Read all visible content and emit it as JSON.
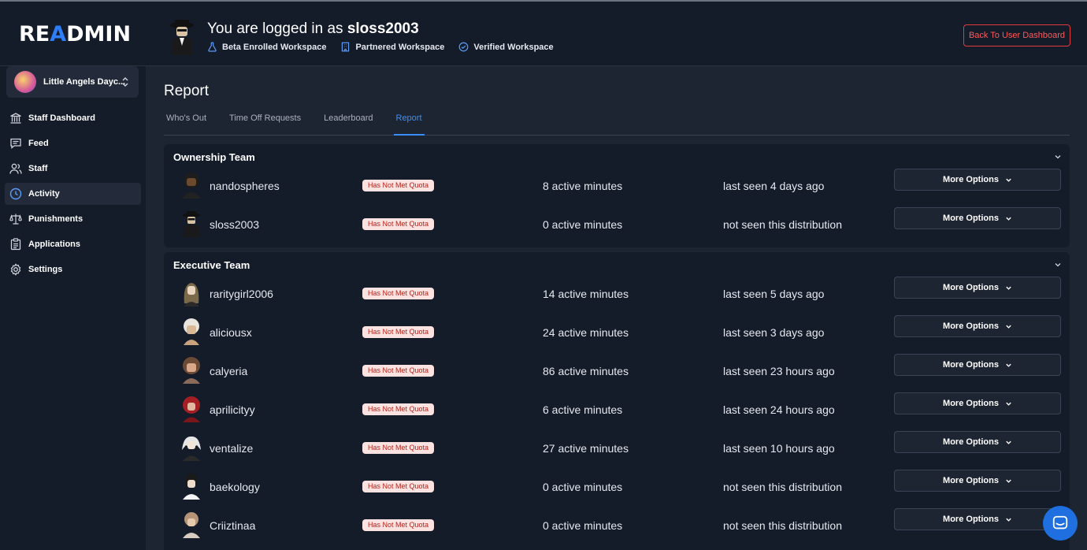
{
  "header": {
    "logo_main": "RE",
    "logo_accent": "A",
    "logo_rest": "DMIN",
    "logged_prefix": "You are logged in as ",
    "username": "sloss2003",
    "badges": [
      "Beta Enrolled Workspace",
      "Partnered Workspace",
      "Verified Workspace"
    ],
    "back_button": "Back To User Dashboard"
  },
  "sidebar": {
    "workspace_name": "Little Angels Dayc...",
    "items": [
      {
        "label": "Staff Dashboard",
        "icon": "bank-icon"
      },
      {
        "label": "Feed",
        "icon": "chat-icon"
      },
      {
        "label": "Staff",
        "icon": "users-icon"
      },
      {
        "label": "Activity",
        "icon": "clock-icon"
      },
      {
        "label": "Punishments",
        "icon": "scale-icon"
      },
      {
        "label": "Applications",
        "icon": "clipboard-icon"
      },
      {
        "label": "Settings",
        "icon": "gear-icon"
      }
    ],
    "active_index": 3
  },
  "main": {
    "title": "Report",
    "tabs": [
      "Who's Out",
      "Time Off Requests",
      "Leaderboard",
      "Report"
    ],
    "active_tab": 3,
    "more_label": "More Options",
    "sections": [
      {
        "title": "Ownership Team",
        "rows": [
          {
            "name": "nandospheres",
            "quota": "Has Not Met Quota",
            "minutes": "8 active minutes",
            "seen": "last seen 4 days ago"
          },
          {
            "name": "sloss2003",
            "quota": "Has Not Met Quota",
            "minutes": "0 active minutes",
            "seen": "not seen this distribution"
          }
        ]
      },
      {
        "title": "Executive Team",
        "rows": [
          {
            "name": "raritygirl2006",
            "quota": "Has Not Met Quota",
            "minutes": "14 active minutes",
            "seen": "last seen 5 days ago"
          },
          {
            "name": "aliciousx",
            "quota": "Has Not Met Quota",
            "minutes": "24 active minutes",
            "seen": "last seen 3 days ago"
          },
          {
            "name": "calyeria",
            "quota": "Has Not Met Quota",
            "minutes": "86 active minutes",
            "seen": "last seen 23 hours ago"
          },
          {
            "name": "aprilicityy",
            "quota": "Has Not Met Quota",
            "minutes": "6 active minutes",
            "seen": "last seen 24 hours ago"
          },
          {
            "name": "ventalize",
            "quota": "Has Not Met Quota",
            "minutes": "27 active minutes",
            "seen": "last seen 10 hours ago"
          },
          {
            "name": "baekology",
            "quota": "Has Not Met Quota",
            "minutes": "0 active minutes",
            "seen": "not seen this distribution"
          },
          {
            "name": "Criiztinaa",
            "quota": "Has Not Met Quota",
            "minutes": "0 active minutes",
            "seen": "not seen this distribution"
          }
        ]
      }
    ]
  },
  "colors": {
    "accent": "#3b8ef7",
    "danger": "#e23b3b",
    "quota_bg": "#fde2e2",
    "quota_text": "#b42318"
  }
}
